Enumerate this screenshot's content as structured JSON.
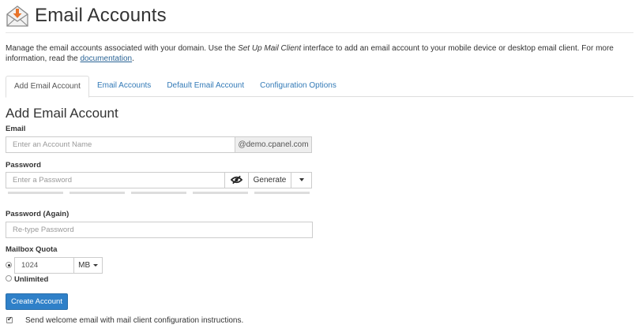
{
  "header": {
    "title": "Email Accounts",
    "icon": "email-download-icon"
  },
  "intro": {
    "text_before": "Manage the email accounts associated with your domain. Use the ",
    "emphasis": "Set Up Mail Client",
    "text_middle": " interface to add an email account to your mobile device or desktop email client. For more information, read the ",
    "link": "documentation",
    "text_after": "."
  },
  "tabs": [
    {
      "label": "Add Email Account",
      "active": true
    },
    {
      "label": "Email Accounts",
      "active": false
    },
    {
      "label": "Default Email Account",
      "active": false
    },
    {
      "label": "Configuration Options",
      "active": false
    }
  ],
  "form": {
    "section_title": "Add Email Account",
    "email": {
      "label": "Email",
      "placeholder": "Enter an Account Name",
      "domain": "@demo.cpanel.com"
    },
    "password": {
      "label": "Password",
      "placeholder": "Enter a Password",
      "visibility_icon": "eye-slash-icon",
      "generate_label": "Generate",
      "dropdown_icon": "caret-down-icon"
    },
    "password_again": {
      "label": "Password (Again)",
      "placeholder": "Re-type Password"
    },
    "quota": {
      "label": "Mailbox Quota",
      "value": "1024",
      "unit": "MB",
      "unlimited_label": "Unlimited",
      "selected": "limited"
    },
    "submit_label": "Create Account",
    "welcome_email": {
      "label": "Send welcome email with mail client configuration instructions.",
      "checked": true
    }
  },
  "colors": {
    "primary": "#2f80c8",
    "link": "#337ab7",
    "icon_accent": "#e8742a"
  }
}
